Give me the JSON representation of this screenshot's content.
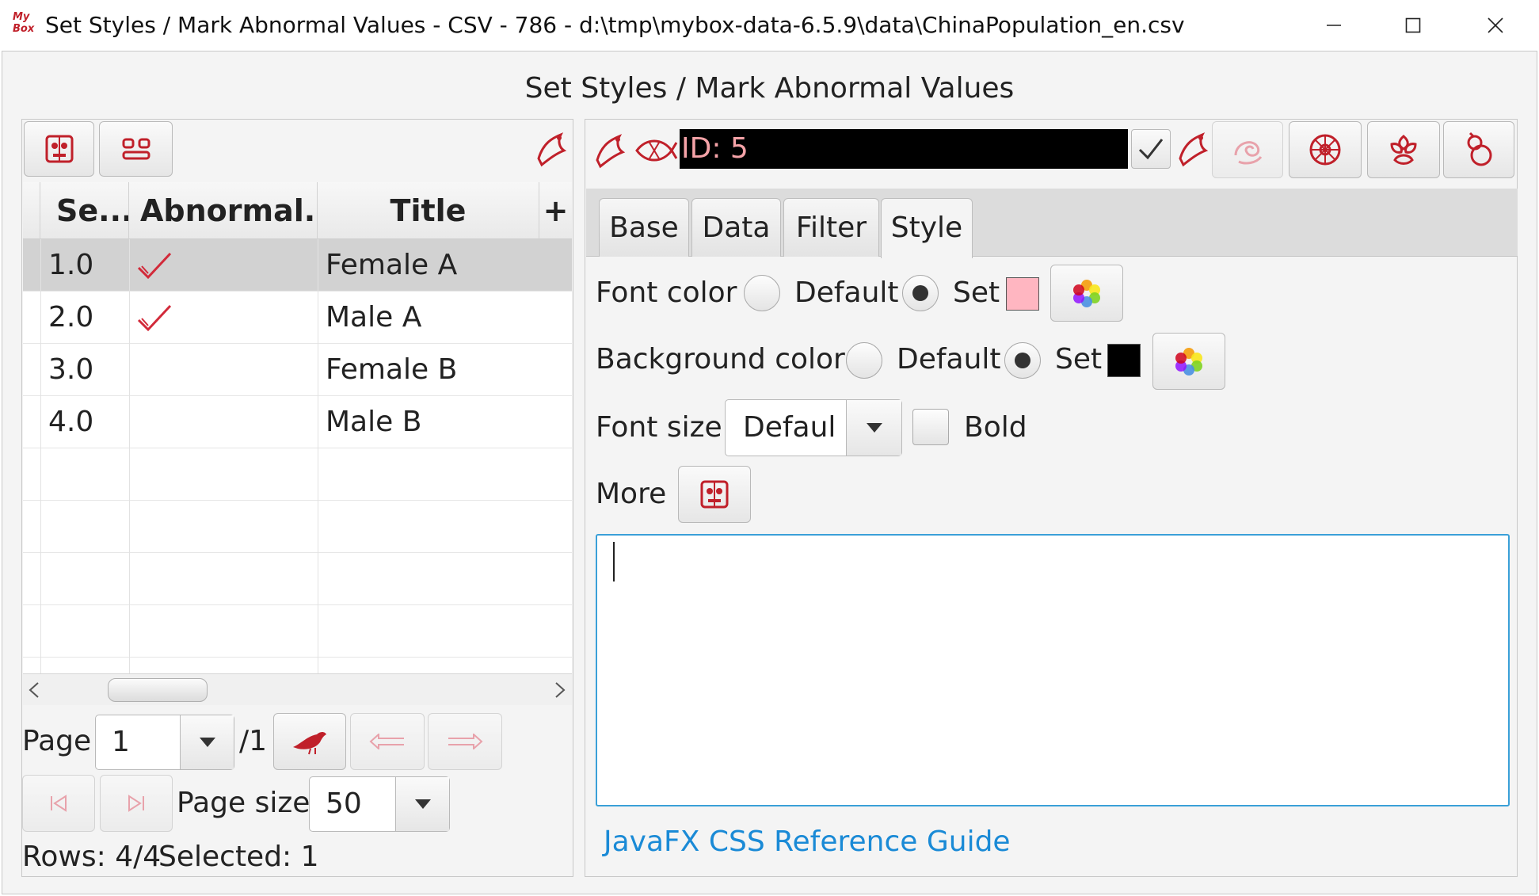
{
  "window": {
    "logo_text": "My Box",
    "title": "Set Styles / Mark Abnormal Values - CSV - 786 - d:\\tmp\\mybox-data-6.5.9\\data\\ChinaPopulation_en.csv"
  },
  "heading": "Set Styles / Mark Abnormal Values",
  "table": {
    "columns": [
      "Se...",
      "Abnormal...",
      "Title"
    ],
    "add_column_symbol": "+",
    "rows": [
      {
        "seq": "1.0",
        "abnormal": true,
        "title": "Female A"
      },
      {
        "seq": "2.0",
        "abnormal": true,
        "title": "Male A"
      },
      {
        "seq": "3.0",
        "abnormal": false,
        "title": "Female B"
      },
      {
        "seq": "4.0",
        "abnormal": false,
        "title": "Male B"
      }
    ]
  },
  "pagination": {
    "page_label": "Page",
    "page_value": "1",
    "page_total": "/1",
    "page_size_label": "Page size",
    "page_size_value": "50"
  },
  "status": {
    "rows": "Rows: 4/4",
    "selected": "Selected: 1"
  },
  "editor": {
    "id_value": "ID: 5",
    "tabs": [
      "Base",
      "Data",
      "Filter",
      "Style"
    ],
    "active_tab": "Style",
    "font_color_label": "Font color",
    "background_color_label": "Background color",
    "default_label": "Default",
    "set_label": "Set",
    "font_color_swatch": "#ffb6c1",
    "background_color_swatch": "#000000",
    "font_size_label": "Font size",
    "font_size_value": "Defaul",
    "bold_label": "Bold",
    "more_label": "More",
    "css_text": "",
    "css_link": "JavaFX CSS Reference Guide"
  },
  "colors": {
    "accent": "#c0202a",
    "link": "#1a8ad6",
    "focus": "#3aa0d8"
  }
}
